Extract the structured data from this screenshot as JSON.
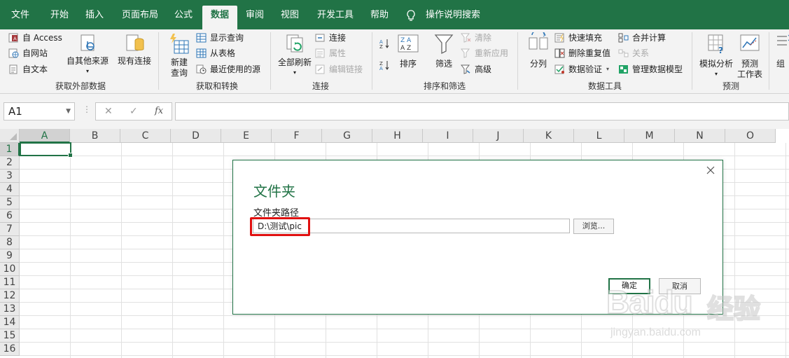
{
  "ribbon_tabs": {
    "file": "文件",
    "home": "开始",
    "insert": "插入",
    "page_layout": "页面布局",
    "formulas": "公式",
    "data": "数据",
    "review": "审阅",
    "view": "视图",
    "developer": "开发工具",
    "help": "帮助",
    "tell_me": "操作说明搜索"
  },
  "groups": {
    "get_external": {
      "label": "获取外部数据",
      "from_access": "自 Access",
      "from_web": "自网站",
      "from_text": "自文本",
      "from_other": "自其他来源",
      "existing": "现有连接"
    },
    "get_transform": {
      "label": "获取和转换",
      "new_query": "新建",
      "new_query_2": "查询",
      "show_queries": "显示查询",
      "from_table": "从表格",
      "recent_sources": "最近使用的源"
    },
    "connections": {
      "label": "连接",
      "refresh_all": "全部刷新",
      "connections": "连接",
      "properties": "属性",
      "edit_links": "编辑链接"
    },
    "sort_filter": {
      "label": "排序和筛选",
      "sort": "排序",
      "filter": "筛选",
      "clear": "清除",
      "reapply": "重新应用",
      "advanced": "高级"
    },
    "data_tools": {
      "label": "数据工具",
      "text_to_columns": "分列",
      "flash_fill": "快速填充",
      "remove_duplicates": "删除重复值",
      "data_validation": "数据验证",
      "consolidate": "合并计算",
      "relationships": "关系",
      "manage_model": "管理数据模型"
    },
    "forecast": {
      "label": "预测",
      "what_if": "模拟分析",
      "forecast_sheet": "预测",
      "forecast_sheet_2": "工作表"
    },
    "outline": {
      "group_partial": "组"
    }
  },
  "formula_bar": {
    "name_box": "A1",
    "fx": "fx",
    "formula": ""
  },
  "columns": [
    "A",
    "B",
    "C",
    "D",
    "E",
    "F",
    "G",
    "H",
    "I",
    "J",
    "K",
    "L",
    "M",
    "N",
    "O"
  ],
  "rows": [
    "1",
    "2",
    "3",
    "4",
    "5",
    "6",
    "7",
    "8",
    "9",
    "10",
    "11",
    "12",
    "13",
    "14",
    "15",
    "16"
  ],
  "dialog": {
    "title": "文件夹",
    "field_label": "文件夹路径",
    "path_value": "D:\\测试\\pic",
    "browse": "浏览...",
    "ok": "确定",
    "cancel": "取消"
  },
  "watermark": {
    "brand": "Baidu",
    "brand_cn": "经验",
    "url": "jingyan.baidu.com"
  },
  "colors": {
    "accent": "#217346",
    "highlight": "#e01010",
    "ribbon_bg": "#f3f3f3"
  }
}
